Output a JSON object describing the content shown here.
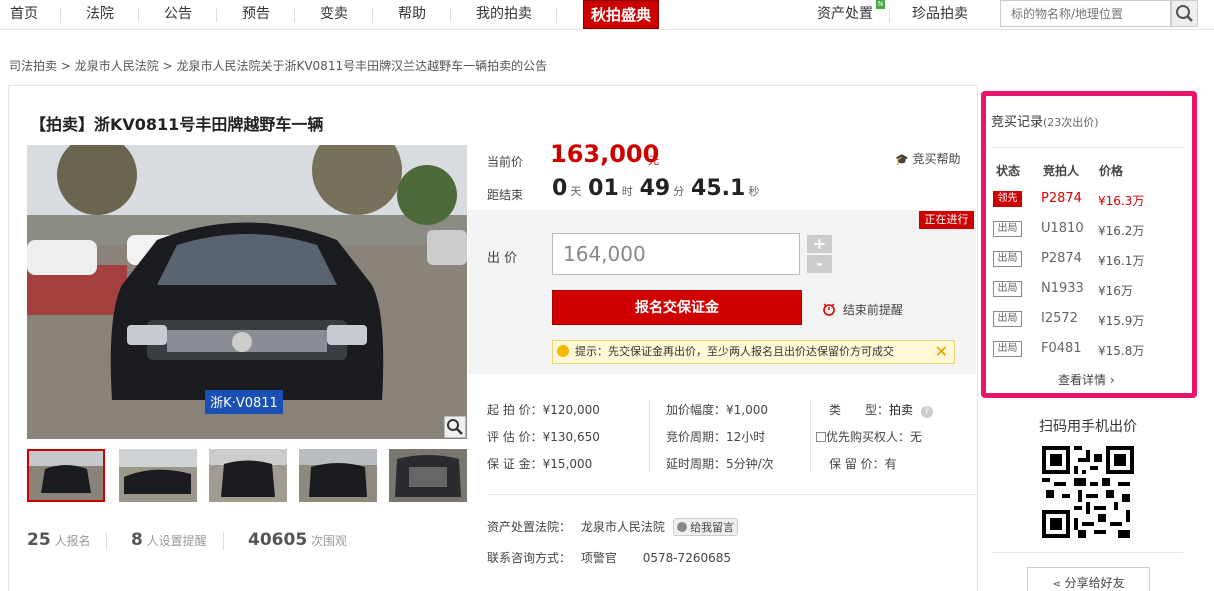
{
  "nav": {
    "items": [
      "首页",
      "法院",
      "公告",
      "预告",
      "变卖",
      "帮助",
      "我的拍卖"
    ],
    "special": "秋拍盛典",
    "right_items": [
      "资产处置",
      "珍品拍卖"
    ],
    "new_badge": "N",
    "search_placeholder": "标的物名称/地理位置"
  },
  "breadcrumb": {
    "items": [
      "司法拍卖",
      "龙泉市人民法院",
      "龙泉市人民法院关于浙KV0811号丰田牌汉兰达越野车一辆拍卖的公告"
    ],
    "separator": ">"
  },
  "item": {
    "title": "【拍卖】浙KV0811号丰田牌越野车一辆",
    "plate": "浙K·V0811"
  },
  "price": {
    "current_label": "当前价",
    "current_value": "163,000",
    "current_unit": "元",
    "remaining_label": "距结束",
    "days": "0",
    "days_unit": "天",
    "hours": "01",
    "hours_unit": "时",
    "minutes": "49",
    "minutes_unit": "分",
    "seconds": "45.1",
    "seconds_unit": "秒",
    "help_label": "竞买帮助"
  },
  "bid": {
    "status": "正在进行",
    "label": "出 价",
    "value": "164,000",
    "plus": "+",
    "minus": "-",
    "deposit_button": "报名交保证金",
    "remind_label": "结束前提醒",
    "tip": "提示：先交保证金再出价，至少两人报名且出价达保留价方可成交",
    "tip_close": "✕"
  },
  "details": {
    "start_price": "起 拍 价：¥120,000",
    "appraisal": "评 估 价：¥130,650",
    "deposit": "保 证 金：¥15,000",
    "increment": "加价幅度：¥1,000",
    "cycle": "竞价周期：12小时",
    "delay": "延时周期：5分钟/次",
    "type_label": "类　　型：",
    "type_value": "拍卖",
    "priority": "优先购买权人：无",
    "reserve": "保 留 价：有"
  },
  "court": {
    "label": "资产处置法院：",
    "name": "龙泉市人民法院",
    "message_button": "给我留言",
    "contact_label": "联系咨询方式：",
    "contact_person": "项警官",
    "phone": "0578-7260685"
  },
  "stats": {
    "signups": "25",
    "signups_label": "人报名",
    "reminders": "8",
    "reminders_label": "人设置提醒",
    "views": "40605",
    "views_label": "次围观"
  },
  "records": {
    "title": "竞买记录",
    "count": "(23次出价)",
    "headers": [
      "状态",
      "竞拍人",
      "价格"
    ],
    "rows": [
      {
        "status": "领先",
        "bidder": "P2874",
        "price": "¥16.3万"
      },
      {
        "status": "出局",
        "bidder": "U1810",
        "price": "¥16.2万"
      },
      {
        "status": "出局",
        "bidder": "P2874",
        "price": "¥16.1万"
      },
      {
        "status": "出局",
        "bidder": "N1933",
        "price": "¥16万"
      },
      {
        "status": "出局",
        "bidder": "I2572",
        "price": "¥15.9万"
      },
      {
        "status": "出局",
        "bidder": "F0481",
        "price": "¥15.8万"
      }
    ],
    "more": "查看详情"
  },
  "qr": {
    "title": "扫码用手机出价"
  },
  "share": {
    "label": "分享给好友"
  },
  "colors": {
    "accent": "#d10000",
    "highlight_border": "#e8156a"
  }
}
